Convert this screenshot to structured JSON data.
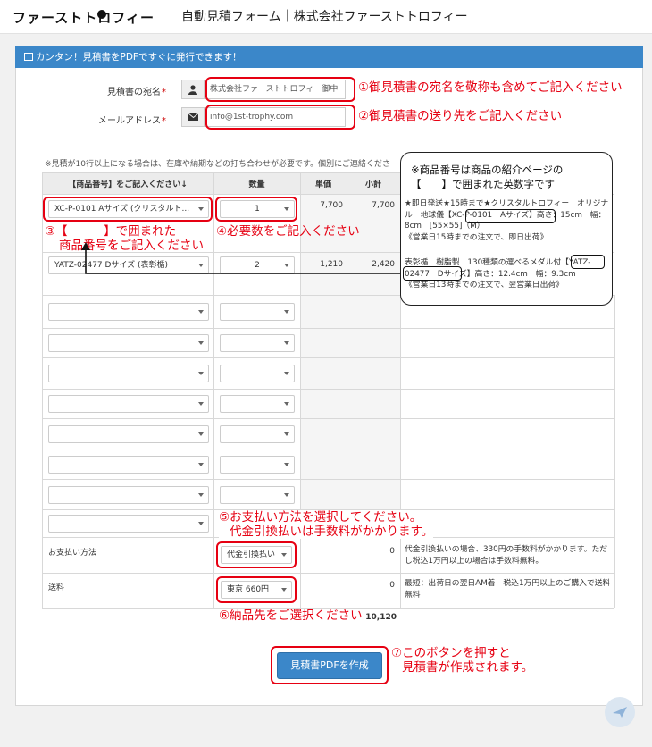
{
  "header": {
    "logo_text": "ファーストトロフィー",
    "title": "自動見積フォーム｜株式会社ファーストトロフィー"
  },
  "panel": {
    "title": "カンタン！見積書をPDFですぐに発行できます！"
  },
  "form": {
    "name_label": "見積書の宛名",
    "name_value": "株式会社ファーストトロフィー御中",
    "email_label": "メールアドレス",
    "email_value": "info@1st-trophy.com",
    "required_mark": "*"
  },
  "notice": "※見積が10行以上になる場合は、在庫や納期などの打ち合わせが必要です。個別にご連絡くださ",
  "table": {
    "headers": [
      "【商品番号】をご記入ください↓",
      "数量",
      "単価",
      "小計"
    ],
    "rows": [
      {
        "product": "XC-P-0101 Aサイズ (クリスタルト...",
        "qty": "1",
        "price": "7,700",
        "subtotal": "7,700",
        "desc1": "★即日発送★15時まで★クリスタルトロフィー　オリジナル　地球儀【XC-P-0101　Aサイズ】高さ：15cm　幅：8cm　[55×55]（M）",
        "desc2": "《営業日15時までの注文で、即日出荷》"
      },
      {
        "product": "YATZ-02477 Dサイズ (表彰楯)",
        "qty": "2",
        "price": "1,210",
        "subtotal": "2,420",
        "desc1": "表彰楯　樹脂製　130種類の選べるメダル付【YATZ-02477　Dサイズ】高さ：12.4cm　幅：9.3cm",
        "desc2": "《営業日13時までの注文で、翌営業日出荷》"
      }
    ],
    "payment_label": "お支払い方法",
    "payment_value": "代金引換払い",
    "payment_amount": "0",
    "payment_note": "代金引換払いの場合、330円の手数料がかかります。ただし税込1万円以上の場合は手数料無料。",
    "shipping_label": "送料",
    "shipping_value": "東京 660円",
    "shipping_amount": "0",
    "shipping_note": "最短：出荷日の翌日AM着　税込1万円以上のご購入で送料無料",
    "total": "10,120"
  },
  "submit_label": "見積書PDFを作成",
  "callouts": {
    "c1": "①御見積書の宛名を敬称も含めてご記入ください",
    "c2": "②御見積書の送り先をご記入ください",
    "c3_line1": "③【　　　】で囲まれた",
    "c3_line2": "商品番号をご記入ください",
    "c4": "④必要数をご記入ください",
    "c5_line1": "⑤お支払い方法を選択してください。",
    "c5_line2": "代金引換払いは手数料がかかります。",
    "c6": "⑥納品先をご選択ください",
    "c7_line1": "⑦このボタンを押すと",
    "c7_line2": "見積書が作成されます。",
    "bubble_line1": "※商品番号は商品の紹介ページの",
    "bubble_line2": "【　　】で囲まれた英数字です"
  }
}
